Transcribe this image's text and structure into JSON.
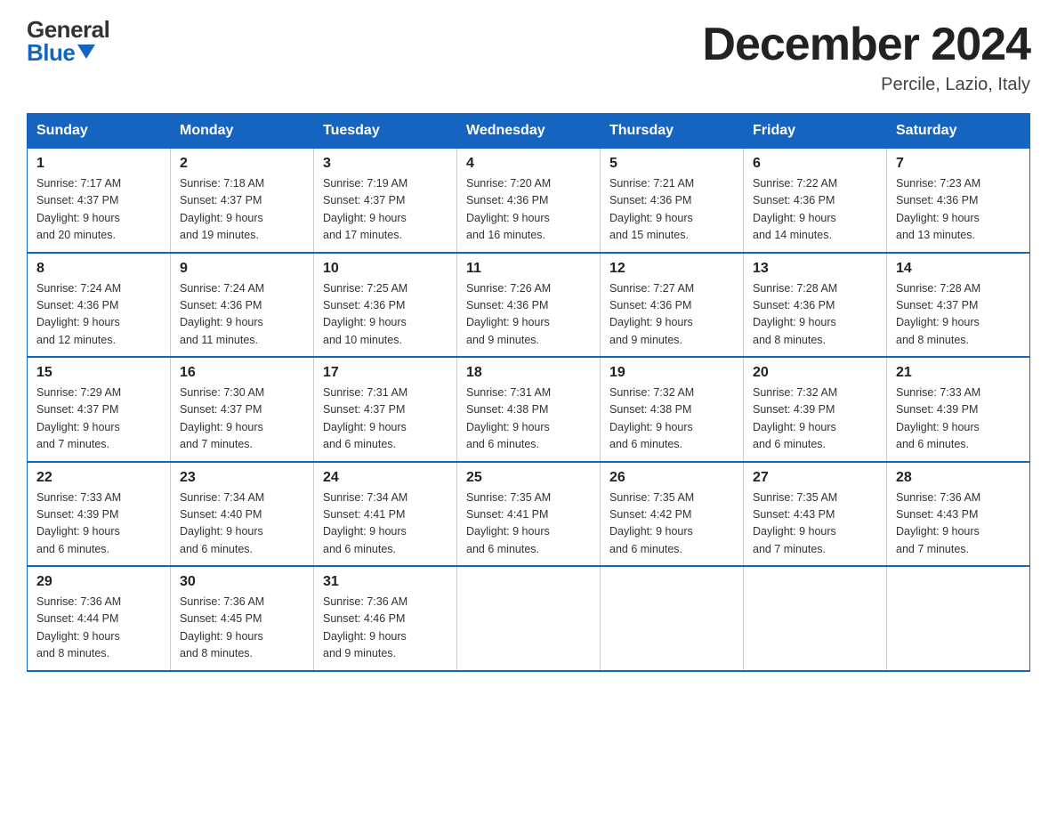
{
  "logo": {
    "general": "General",
    "blue": "Blue"
  },
  "title": "December 2024",
  "location": "Percile, Lazio, Italy",
  "days_header": [
    "Sunday",
    "Monday",
    "Tuesday",
    "Wednesday",
    "Thursday",
    "Friday",
    "Saturday"
  ],
  "weeks": [
    [
      {
        "day": "1",
        "sunrise": "7:17 AM",
        "sunset": "4:37 PM",
        "daylight": "9 hours and 20 minutes."
      },
      {
        "day": "2",
        "sunrise": "7:18 AM",
        "sunset": "4:37 PM",
        "daylight": "9 hours and 19 minutes."
      },
      {
        "day": "3",
        "sunrise": "7:19 AM",
        "sunset": "4:37 PM",
        "daylight": "9 hours and 17 minutes."
      },
      {
        "day": "4",
        "sunrise": "7:20 AM",
        "sunset": "4:36 PM",
        "daylight": "9 hours and 16 minutes."
      },
      {
        "day": "5",
        "sunrise": "7:21 AM",
        "sunset": "4:36 PM",
        "daylight": "9 hours and 15 minutes."
      },
      {
        "day": "6",
        "sunrise": "7:22 AM",
        "sunset": "4:36 PM",
        "daylight": "9 hours and 14 minutes."
      },
      {
        "day": "7",
        "sunrise": "7:23 AM",
        "sunset": "4:36 PM",
        "daylight": "9 hours and 13 minutes."
      }
    ],
    [
      {
        "day": "8",
        "sunrise": "7:24 AM",
        "sunset": "4:36 PM",
        "daylight": "9 hours and 12 minutes."
      },
      {
        "day": "9",
        "sunrise": "7:24 AM",
        "sunset": "4:36 PM",
        "daylight": "9 hours and 11 minutes."
      },
      {
        "day": "10",
        "sunrise": "7:25 AM",
        "sunset": "4:36 PM",
        "daylight": "9 hours and 10 minutes."
      },
      {
        "day": "11",
        "sunrise": "7:26 AM",
        "sunset": "4:36 PM",
        "daylight": "9 hours and 9 minutes."
      },
      {
        "day": "12",
        "sunrise": "7:27 AM",
        "sunset": "4:36 PM",
        "daylight": "9 hours and 9 minutes."
      },
      {
        "day": "13",
        "sunrise": "7:28 AM",
        "sunset": "4:36 PM",
        "daylight": "9 hours and 8 minutes."
      },
      {
        "day": "14",
        "sunrise": "7:28 AM",
        "sunset": "4:37 PM",
        "daylight": "9 hours and 8 minutes."
      }
    ],
    [
      {
        "day": "15",
        "sunrise": "7:29 AM",
        "sunset": "4:37 PM",
        "daylight": "9 hours and 7 minutes."
      },
      {
        "day": "16",
        "sunrise": "7:30 AM",
        "sunset": "4:37 PM",
        "daylight": "9 hours and 7 minutes."
      },
      {
        "day": "17",
        "sunrise": "7:31 AM",
        "sunset": "4:37 PM",
        "daylight": "9 hours and 6 minutes."
      },
      {
        "day": "18",
        "sunrise": "7:31 AM",
        "sunset": "4:38 PM",
        "daylight": "9 hours and 6 minutes."
      },
      {
        "day": "19",
        "sunrise": "7:32 AM",
        "sunset": "4:38 PM",
        "daylight": "9 hours and 6 minutes."
      },
      {
        "day": "20",
        "sunrise": "7:32 AM",
        "sunset": "4:39 PM",
        "daylight": "9 hours and 6 minutes."
      },
      {
        "day": "21",
        "sunrise": "7:33 AM",
        "sunset": "4:39 PM",
        "daylight": "9 hours and 6 minutes."
      }
    ],
    [
      {
        "day": "22",
        "sunrise": "7:33 AM",
        "sunset": "4:39 PM",
        "daylight": "9 hours and 6 minutes."
      },
      {
        "day": "23",
        "sunrise": "7:34 AM",
        "sunset": "4:40 PM",
        "daylight": "9 hours and 6 minutes."
      },
      {
        "day": "24",
        "sunrise": "7:34 AM",
        "sunset": "4:41 PM",
        "daylight": "9 hours and 6 minutes."
      },
      {
        "day": "25",
        "sunrise": "7:35 AM",
        "sunset": "4:41 PM",
        "daylight": "9 hours and 6 minutes."
      },
      {
        "day": "26",
        "sunrise": "7:35 AM",
        "sunset": "4:42 PM",
        "daylight": "9 hours and 6 minutes."
      },
      {
        "day": "27",
        "sunrise": "7:35 AM",
        "sunset": "4:43 PM",
        "daylight": "9 hours and 7 minutes."
      },
      {
        "day": "28",
        "sunrise": "7:36 AM",
        "sunset": "4:43 PM",
        "daylight": "9 hours and 7 minutes."
      }
    ],
    [
      {
        "day": "29",
        "sunrise": "7:36 AM",
        "sunset": "4:44 PM",
        "daylight": "9 hours and 8 minutes."
      },
      {
        "day": "30",
        "sunrise": "7:36 AM",
        "sunset": "4:45 PM",
        "daylight": "9 hours and 8 minutes."
      },
      {
        "day": "31",
        "sunrise": "7:36 AM",
        "sunset": "4:46 PM",
        "daylight": "9 hours and 9 minutes."
      },
      null,
      null,
      null,
      null
    ]
  ],
  "labels": {
    "sunrise": "Sunrise:",
    "sunset": "Sunset:",
    "daylight": "Daylight:"
  }
}
